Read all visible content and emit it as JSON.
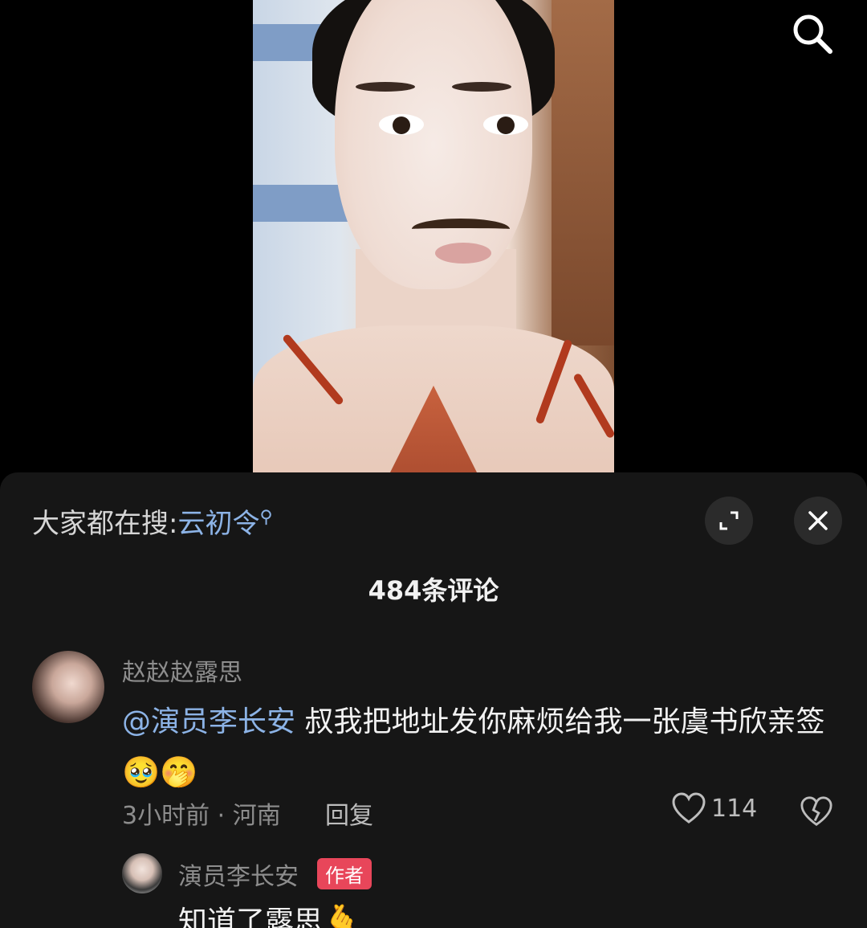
{
  "video": {
    "search_icon": "search-icon"
  },
  "sheet": {
    "trending_prefix": "大家都在搜:",
    "trending_keyword": "云初令",
    "expand_icon": "expand-icon",
    "close_icon": "close-icon",
    "comment_count": "484条评论"
  },
  "comments": [
    {
      "username": "赵赵赵露思",
      "mention": "@演员李长安",
      "text": " 叔我把地址发你麻烦给我一张虞书欣亲签",
      "emojis": "🥹🤭",
      "meta": "3小时前 · 河南",
      "reply_label": "回复",
      "likes": "114"
    }
  ],
  "reply": {
    "username": "演员李长安",
    "badge": "作者",
    "text": "知道了露思",
    "emoji": "🫰"
  },
  "colors": {
    "sheet_bg": "#161616",
    "mention": "#8cb3e6",
    "badge": "#e8465a"
  }
}
